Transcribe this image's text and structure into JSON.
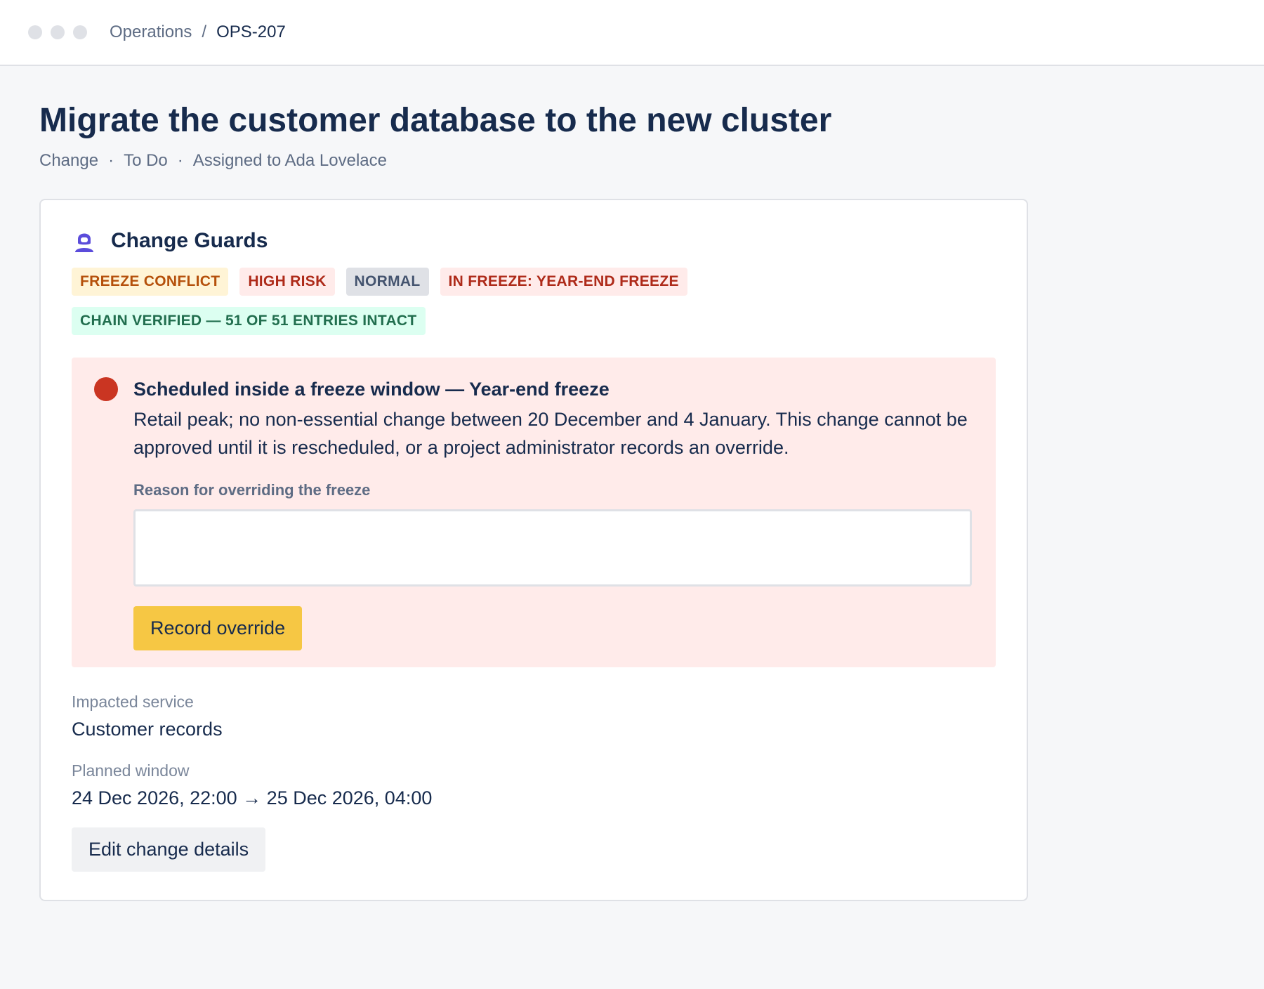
{
  "breadcrumb": {
    "project": "Operations",
    "separator": "/",
    "issue_key": "OPS-207"
  },
  "issue": {
    "title": "Migrate the customer database to the new cluster",
    "type": "Change",
    "status": "To Do",
    "assignee": "Assigned to Ada Lovelace",
    "meta_separator": "·"
  },
  "guards": {
    "heading": "Change Guards",
    "icon": "guard-icon",
    "badges": [
      {
        "label": "FREEZE CONFLICT",
        "color": "#b5500b",
        "bg": "#fff4d6"
      },
      {
        "label": "HIGH RISK",
        "color": "#ae2a19",
        "bg": "#ffebea"
      },
      {
        "label": "NORMAL",
        "color": "#44546f",
        "bg": "#dfe1e6"
      },
      {
        "label": "IN FREEZE: YEAR-END FREEZE",
        "color": "#ae2a19",
        "bg": "#ffebea"
      },
      {
        "label": "CHAIN VERIFIED — 51 OF 51 ENTRIES INTACT",
        "color": "#216e4e",
        "bg": "#dcfff1"
      }
    ],
    "alert": {
      "title": "Scheduled inside a freeze window — Year-end freeze",
      "text": "Retail peak; no non-essential change between 20 December and 4 January. This change cannot be approved until it is rescheduled, or a project administrator records an override.",
      "override_label": "Reason for overriding the freeze",
      "override_value": "",
      "override_button": "Record override",
      "color": "#ca3522"
    },
    "fields": [
      {
        "label": "Impacted service",
        "value": "Customer records"
      },
      {
        "label": "Planned window",
        "value": "24 Dec 2026, 22:00 → 25 Dec 2026, 04:00"
      }
    ],
    "edit_button": "Edit change details"
  },
  "colors": {
    "accent": "#5b4cdb",
    "primary_button": "#f6c744",
    "text": "#172b4d"
  }
}
